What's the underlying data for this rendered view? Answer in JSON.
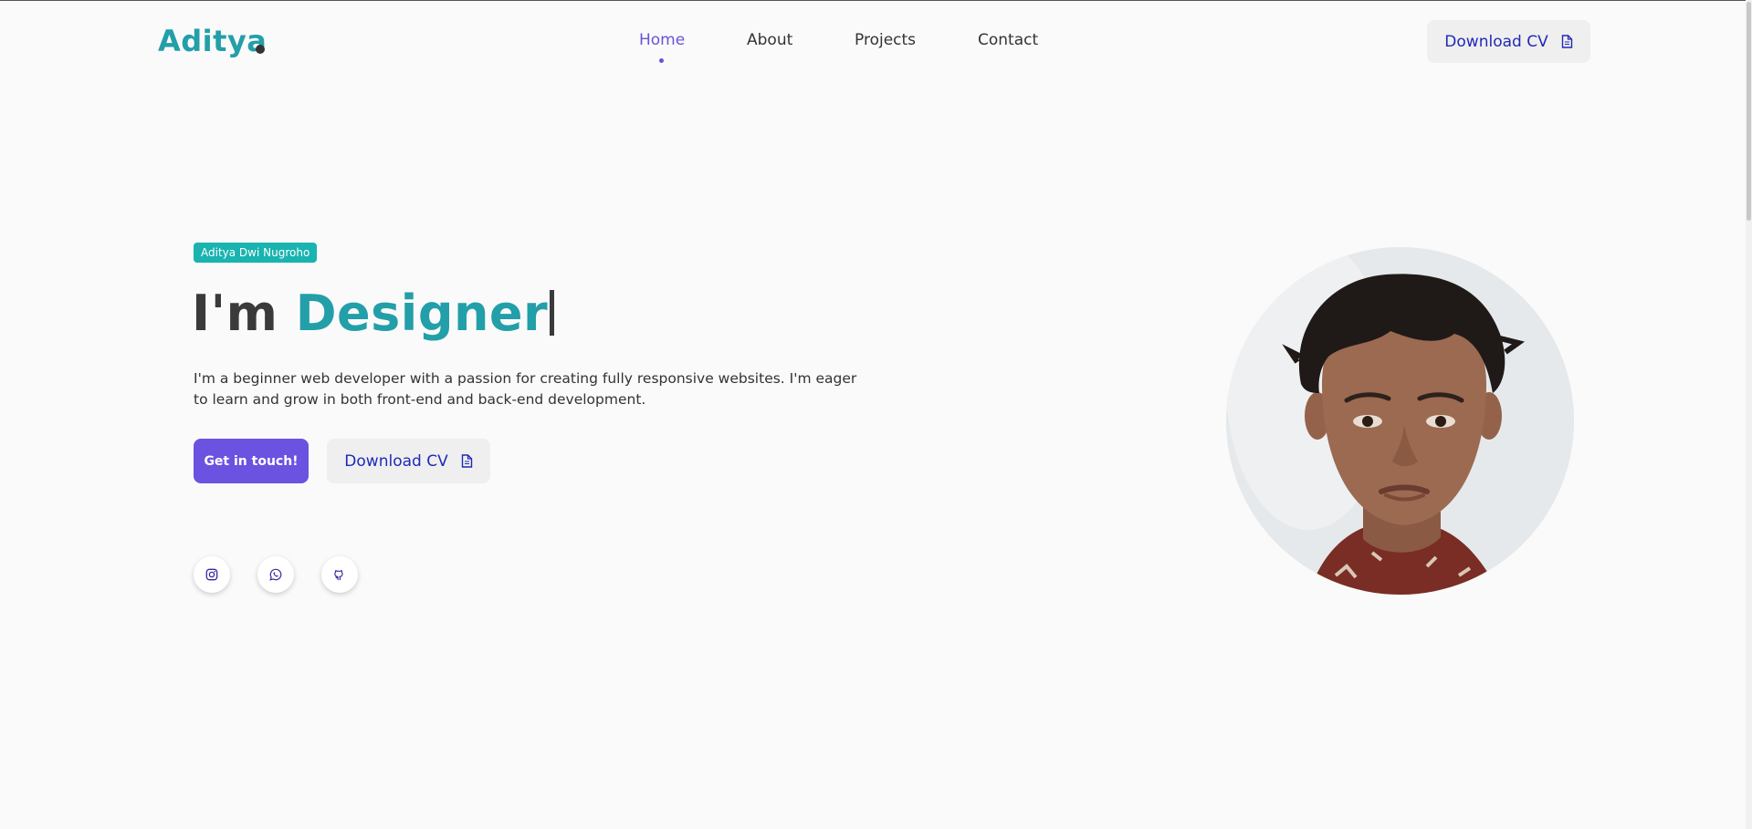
{
  "header": {
    "logo": "Aditya",
    "nav": [
      {
        "label": "Home",
        "active": true
      },
      {
        "label": "About",
        "active": false
      },
      {
        "label": "Projects",
        "active": false
      },
      {
        "label": "Contact",
        "active": false
      }
    ],
    "cv_button": {
      "label": "Download CV",
      "icon": "document-icon"
    }
  },
  "hero": {
    "badge": "Aditya Dwi Nugroho",
    "headline_prefix": "I'm",
    "headline_accent": "Designer",
    "description": "I'm a beginner web developer with a passion for creating fully responsive websites. I'm eager to learn and grow in both front-end and back-end development.",
    "primary_button": "Get in touch!",
    "secondary_button": {
      "label": "Download CV",
      "icon": "document-icon"
    },
    "social_links": [
      {
        "icon": "instagram-icon"
      },
      {
        "icon": "whatsapp-icon"
      },
      {
        "icon": "github-icon"
      }
    ]
  },
  "profile": {
    "image": "profile-photo"
  },
  "colors": {
    "accent_teal": "#229fa9",
    "accent_purple": "#6c52e0",
    "link_blue": "#1f2ab8",
    "badge_teal": "#19b3b0",
    "background": "#fafafa"
  }
}
